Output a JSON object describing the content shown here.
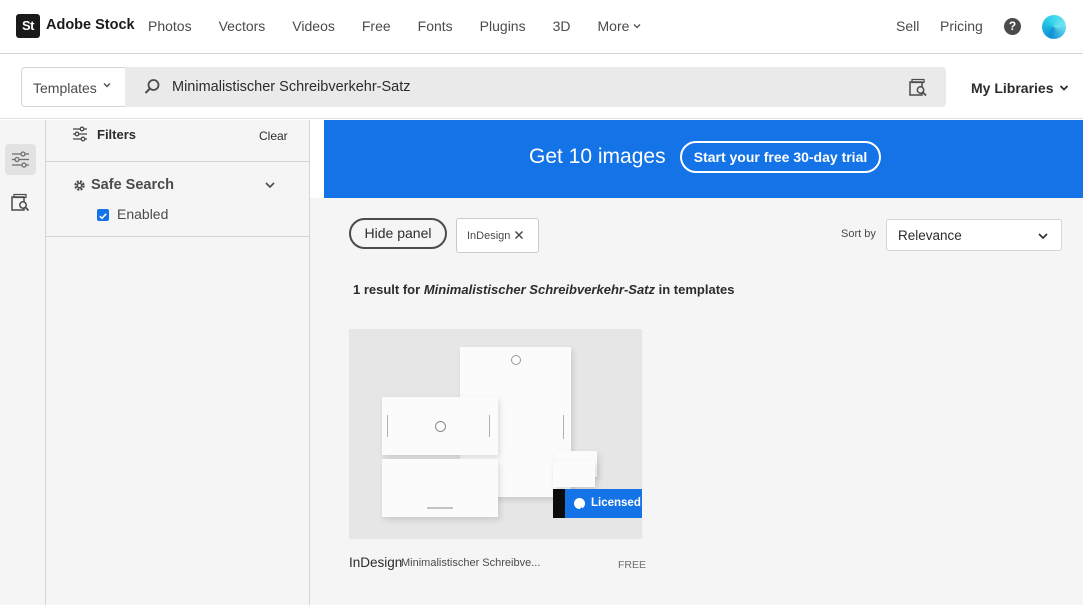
{
  "header": {
    "logo_text": "St",
    "brand": "Adobe Stock",
    "nav": [
      "Photos",
      "Vectors",
      "Videos",
      "Free",
      "Fonts",
      "Plugins",
      "3D"
    ],
    "more_label": "More",
    "sell": "Sell",
    "pricing": "Pricing",
    "help_icon": "?"
  },
  "search": {
    "scope": "Templates",
    "query": "Minimalistischer Schreibverkehr-Satz",
    "my_libraries": "My Libraries"
  },
  "filters": {
    "title": "Filters",
    "clear": "Clear",
    "safe_search": {
      "title": "Safe Search",
      "option": "Enabled",
      "checked": true
    }
  },
  "banner": {
    "text": "Get 10 images",
    "button": "Start your free 30-day trial"
  },
  "toolbar": {
    "hide_panel": "Hide panel",
    "tag": "InDesign",
    "sort_by_label": "Sort by",
    "sort_value": "Relevance"
  },
  "results": {
    "prefix": "1 result for",
    "query": "Minimalistischer Schreibverkehr-Satz",
    "suffix": "in templates"
  },
  "card": {
    "badge": "Licensed",
    "type": "InDesign",
    "title": "Minimalistischer Schreibve...",
    "price": "FREE"
  },
  "colors": {
    "accent": "#1473e6",
    "panel_bg": "#f5f5f5"
  }
}
